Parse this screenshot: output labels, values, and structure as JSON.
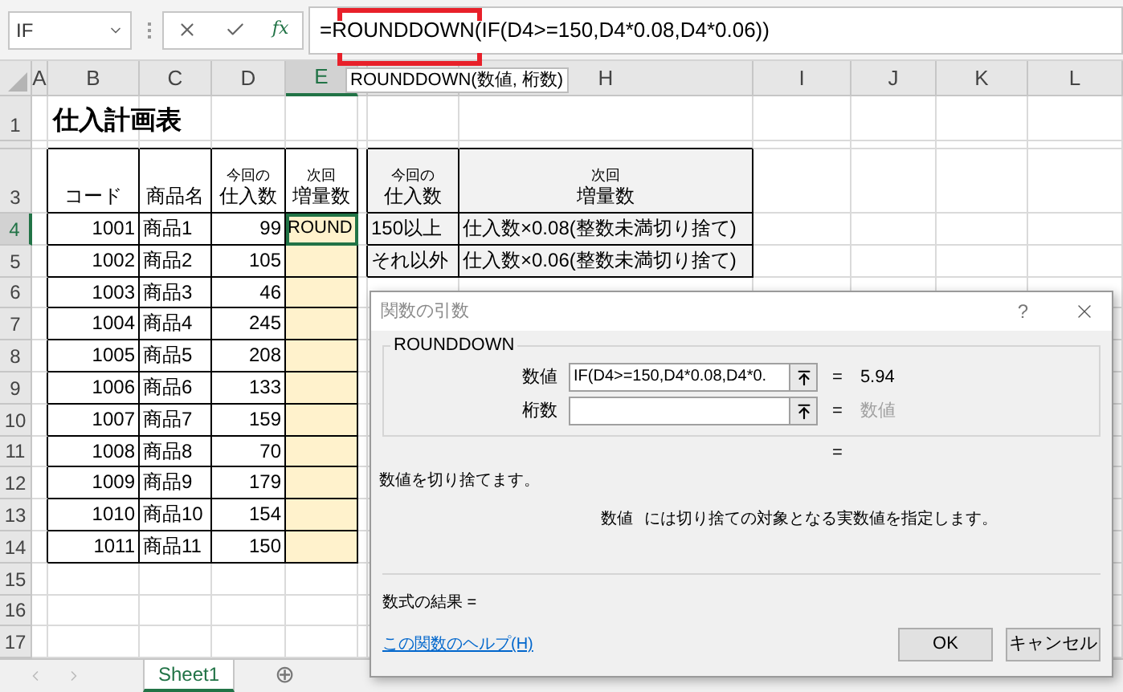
{
  "name_box": {
    "value": "IF"
  },
  "formula_bar": {
    "fx": "fx",
    "formula": "=ROUNDDOWN(IF(D4>=150,D4*0.08,D4*0.06))"
  },
  "tooltip": {
    "text": "ROUNDDOWN(数値, 桁数)"
  },
  "columns": [
    {
      "label": "A",
      "selected": false
    },
    {
      "label": "B",
      "selected": false
    },
    {
      "label": "C",
      "selected": false
    },
    {
      "label": "D",
      "selected": false
    },
    {
      "label": "E",
      "selected": true
    },
    {
      "selected": false
    },
    {
      "selected": false
    },
    {
      "label": "H",
      "selected": false
    },
    {
      "label": "I",
      "selected": false
    },
    {
      "label": "J",
      "selected": false
    },
    {
      "label": "K",
      "selected": false
    },
    {
      "label": "L",
      "selected": false
    }
  ],
  "rows": [
    {
      "label": "1",
      "selected": false
    },
    {
      "selected": false
    },
    {
      "label": "3",
      "selected": false
    },
    {
      "label": "4",
      "selected": true
    },
    {
      "label": "5",
      "selected": false
    },
    {
      "label": "6",
      "selected": false
    },
    {
      "label": "7",
      "selected": false
    },
    {
      "label": "8",
      "selected": false
    },
    {
      "label": "9",
      "selected": false
    },
    {
      "label": "10",
      "selected": false
    },
    {
      "label": "11",
      "selected": false
    },
    {
      "label": "12",
      "selected": false
    },
    {
      "label": "13",
      "selected": false
    },
    {
      "label": "14",
      "selected": false
    },
    {
      "label": "15",
      "selected": false
    },
    {
      "label": "16",
      "selected": false
    },
    {
      "label": "17",
      "selected": false
    }
  ],
  "sheet": {
    "title": "仕入計画表",
    "table1": {
      "headers": [
        {
          "main": "コード"
        },
        {
          "main": "商品名"
        },
        {
          "small": "今回の",
          "main": "仕入数"
        },
        {
          "small": "次回",
          "main": "増量数"
        }
      ],
      "rows": [
        {
          "code": "1001",
          "name": "商品1",
          "qty": "99",
          "next": "ROUND"
        },
        {
          "code": "1002",
          "name": "商品2",
          "qty": "105"
        },
        {
          "code": "1003",
          "name": "商品3",
          "qty": "46"
        },
        {
          "code": "1004",
          "name": "商品4",
          "qty": "245"
        },
        {
          "code": "1005",
          "name": "商品5",
          "qty": "208"
        },
        {
          "code": "1006",
          "name": "商品6",
          "qty": "133"
        },
        {
          "code": "1007",
          "name": "商品7",
          "qty": "159"
        },
        {
          "code": "1008",
          "name": "商品8",
          "qty": "70"
        },
        {
          "code": "1009",
          "name": "商品9",
          "qty": "179"
        },
        {
          "code": "1010",
          "name": "商品10",
          "qty": "154"
        },
        {
          "code": "1011",
          "name": "商品11",
          "qty": "150"
        }
      ]
    },
    "table2": {
      "headers": [
        {
          "small": "今回の",
          "main": "仕入数"
        },
        {
          "small": "次回",
          "main": "増量数"
        }
      ],
      "rows": [
        {
          "condition": "150以上",
          "rule": "仕入数×0.08(整数未満切り捨て)"
        },
        {
          "condition": "それ以外",
          "rule": "仕入数×0.06(整数未満切り捨て)"
        }
      ]
    }
  },
  "dialog": {
    "title": "関数の引数",
    "help": "?",
    "function": "ROUNDDOWN",
    "args": [
      {
        "label": "数値",
        "value": "IF(D4>=150,D4*0.08,D4*0.",
        "equals": "=",
        "result": "5.94",
        "dimmed": false
      },
      {
        "label": "桁数",
        "equals": "=",
        "result": "数値",
        "dimmed": true
      }
    ],
    "total_equals": "=",
    "description": "数値を切り捨てます。",
    "arg_help_name": "数値",
    "arg_help": "には切り捨ての対象となる実数値を指定します。",
    "result_label": "数式の結果 =",
    "help_link": "この関数のヘルプ(H)",
    "buttons": [
      "OK",
      "キャンセル"
    ]
  },
  "sheet_tabs": [
    {
      "label": "Sheet1",
      "selected": true
    }
  ],
  "add_sheet": "⊕"
}
